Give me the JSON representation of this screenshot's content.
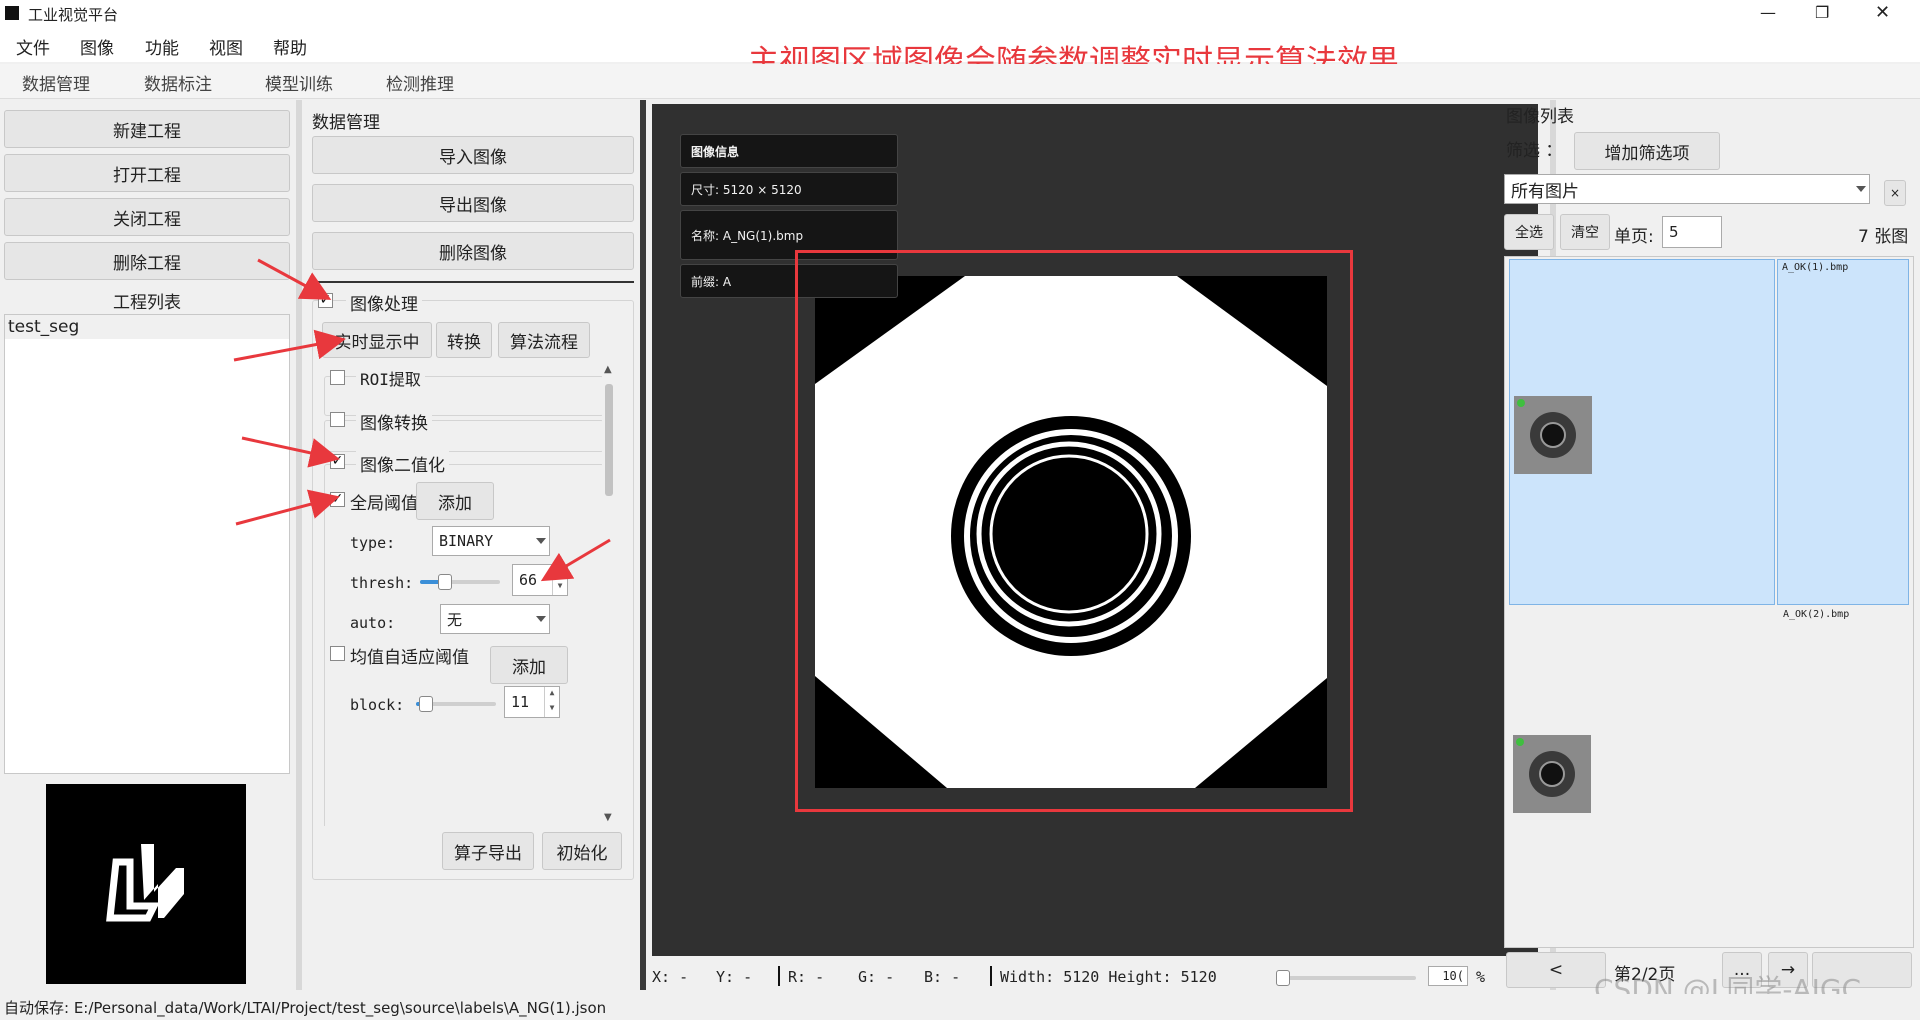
{
  "window": {
    "title": "工业视觉平台",
    "controls": [
      "—",
      "❐",
      "✕"
    ]
  },
  "menubar": [
    "文件",
    "图像",
    "功能",
    "视图",
    "帮助"
  ],
  "banner": "主视图区域图像会随参数调整实时显示算法效果",
  "tabs": [
    "数据管理",
    "数据标注",
    "模型训练",
    "检测推理"
  ],
  "project": {
    "buttons": [
      "新建工程",
      "打开工程",
      "关闭工程",
      "删除工程"
    ],
    "list_title": "工程列表",
    "items": [
      "test_seg"
    ]
  },
  "data_panel": {
    "title": "数据管理",
    "buttons": [
      "导入图像",
      "导出图像",
      "删除图像"
    ],
    "image_processing": {
      "label": "图像处理",
      "checked": true,
      "mode_buttons": [
        "实时显示中",
        "转换",
        "算法流程"
      ],
      "sections": [
        {
          "label": "ROI提取",
          "checked": false
        },
        {
          "label": "图像转换",
          "checked": false
        },
        {
          "label": "图像二值化",
          "checked": true
        }
      ],
      "global_threshold": {
        "label": "全局阈值",
        "checked": true,
        "add_label": "添加",
        "type_label": "type:",
        "type_value": "BINARY",
        "thresh_label": "thresh:",
        "thresh_value": "66",
        "thresh_fraction": 0.26,
        "auto_label": "auto:",
        "auto_value": "无"
      },
      "adaptive_threshold": {
        "label": "均值自适应阈值",
        "checked": false,
        "add_label": "添加",
        "block_label": "block:",
        "block_value": "11",
        "block_fraction": 0.05
      },
      "bottom_buttons": [
        "算子导出",
        "初始化"
      ]
    }
  },
  "viewer": {
    "info": {
      "header": "图像信息",
      "size": "尺寸: 5120 × 5120",
      "name": "名称: A_NG(1).bmp",
      "prefix": "前缀: A"
    },
    "status": {
      "x": "X:  -",
      "y": "Y:  -",
      "r": "R:  -",
      "g": "G:  -",
      "b": "B:  -",
      "dims": "Width: 5120 Height: 5120",
      "zoom_value": "10(",
      "zoom_unit": "%",
      "zoom_fraction": 0.0
    }
  },
  "image_list": {
    "title": "图像列表",
    "filter_label": "筛选 ：",
    "add_filter": "增加筛选项",
    "filter_value": "所有图片",
    "filter_clear": "×",
    "select_all": "全选",
    "clear": "清空",
    "per_page_label": "单页:",
    "per_page_value": "5",
    "count": "7 张图",
    "thumbs": [
      {
        "name": "A_OK(1).bmp"
      },
      {
        "name": "A_OK(2).bmp"
      }
    ],
    "pager": {
      "prev": "<",
      "page": "第2/2页",
      "more": "...",
      "next": "→"
    }
  },
  "statusbar": "自动保存: E:/Personal_data/Work/LTAI/Project/test_seg\\source\\labels\\A_NG(1).json",
  "watermark": "CSDN @L同学-AIGC",
  "colors": {
    "annotation_red": "#e8383d",
    "selection_blue": "#cce4fb",
    "viewer_bg": "#303030"
  }
}
